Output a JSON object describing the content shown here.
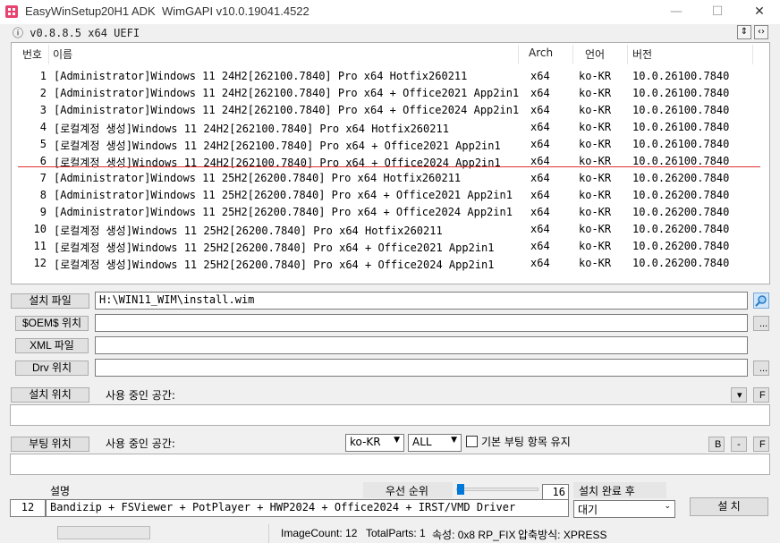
{
  "titlebar": {
    "app_name": "EasyWinSetup",
    "edition": "20H1 ADK",
    "api": "WimGAPI v10.0.19041.4522",
    "minimize": "—",
    "maximize": "☐",
    "close": "✕"
  },
  "version_line": "ⓘ v0.8.8.5 x64 UEFI",
  "list": {
    "headers": {
      "no": "번호",
      "name": "이름",
      "arch": "Arch",
      "lang": "언어",
      "version": "버전"
    },
    "rows": [
      {
        "no": "1",
        "name": "[Administrator]Windows 11 24H2[262100.7840] Pro x64 Hotfix260211",
        "arch": "x64",
        "lang": "ko-KR",
        "version": "10.0.26100.7840"
      },
      {
        "no": "2",
        "name": "[Administrator]Windows 11 24H2[262100.7840] Pro x64 + Office2021 App2in1",
        "arch": "x64",
        "lang": "ko-KR",
        "version": "10.0.26100.7840"
      },
      {
        "no": "3",
        "name": "[Administrator]Windows 11 24H2[262100.7840] Pro x64 + Office2024 App2in1",
        "arch": "x64",
        "lang": "ko-KR",
        "version": "10.0.26100.7840"
      },
      {
        "no": "4",
        "name": "[로컬계정 생성]Windows 11 24H2[262100.7840] Pro x64 Hotfix260211",
        "arch": "x64",
        "lang": "ko-KR",
        "version": "10.0.26100.7840"
      },
      {
        "no": "5",
        "name": "[로컬계정 생성]Windows 11 24H2[262100.7840] Pro x64 + Office2021 App2in1",
        "arch": "x64",
        "lang": "ko-KR",
        "version": "10.0.26100.7840"
      },
      {
        "no": "6",
        "name": "[로컬계정 생성]Windows 11 24H2[262100.7840] Pro x64 + Office2024 App2in1",
        "arch": "x64",
        "lang": "ko-KR",
        "version": "10.0.26100.7840"
      },
      {
        "no": "7",
        "name": "[Administrator]Windows 11 25H2[26200.7840] Pro x64 Hotfix260211",
        "arch": "x64",
        "lang": "ko-KR",
        "version": "10.0.26200.7840"
      },
      {
        "no": "8",
        "name": "[Administrator]Windows 11 25H2[26200.7840] Pro x64 + Office2021 App2in1",
        "arch": "x64",
        "lang": "ko-KR",
        "version": "10.0.26200.7840"
      },
      {
        "no": "9",
        "name": "[Administrator]Windows 11 25H2[26200.7840] Pro x64 + Office2024 App2in1",
        "arch": "x64",
        "lang": "ko-KR",
        "version": "10.0.26200.7840"
      },
      {
        "no": "10",
        "name": "[로컬계정 생성]Windows 11 25H2[26200.7840] Pro x64 Hotfix260211",
        "arch": "x64",
        "lang": "ko-KR",
        "version": "10.0.26200.7840"
      },
      {
        "no": "11",
        "name": "[로컬계정 생성]Windows 11 25H2[26200.7840] Pro x64 + Office2021 App2in1",
        "arch": "x64",
        "lang": "ko-KR",
        "version": "10.0.26200.7840"
      },
      {
        "no": "12",
        "name": "[로컬계정 생성]Windows 11 25H2[26200.7840] Pro x64 + Office2024 App2in1",
        "arch": "x64",
        "lang": "ko-KR",
        "version": "10.0.26200.7840"
      }
    ]
  },
  "install_file": {
    "label": "설치 파일",
    "value": "H:\\WIN11_WIM\\install.wim",
    "icon": "search-icon"
  },
  "oem": {
    "label": "$OEM$ 위치",
    "value": "",
    "browse": "..."
  },
  "xml": {
    "label": "XML 파일",
    "value": ""
  },
  "drv": {
    "label": "Drv 위치",
    "value": "",
    "browse": "..."
  },
  "install_location": {
    "label": "설치 위치",
    "used_space_label": "사용 중인 공간:",
    "dropdown": "▾",
    "f_button": "F"
  },
  "boot_location": {
    "label": "부팅 위치",
    "used_space_label": "사용 중인 공간:",
    "lang_select": "ko-KR",
    "scope_select": "ALL",
    "keep_default_label": "기본 부팅 항목 유지",
    "keep_default_checked": false,
    "b_button": "B",
    "minus_button": "-",
    "f_button": "F"
  },
  "bottom": {
    "description_header": "설명",
    "priority_header": "우선 순위",
    "priority_value": "16",
    "after_install_header": "설치 완료 후",
    "index_value": "12",
    "description_value": "Bandizip + FSViewer + PotPlayer + HWP2024 + Office2024 + IRST/VMD Driver",
    "after_install_value": "대기",
    "install_button": "설 치"
  },
  "status_bar": {
    "image_count": "ImageCount: 12",
    "total_parts": "TotalParts: 1",
    "attributes": "속성: 0x8 RP_FIX",
    "compression": "압축방식: XPRESS"
  },
  "colors": {
    "separator": "#e03030",
    "accent": "#0078d7"
  }
}
